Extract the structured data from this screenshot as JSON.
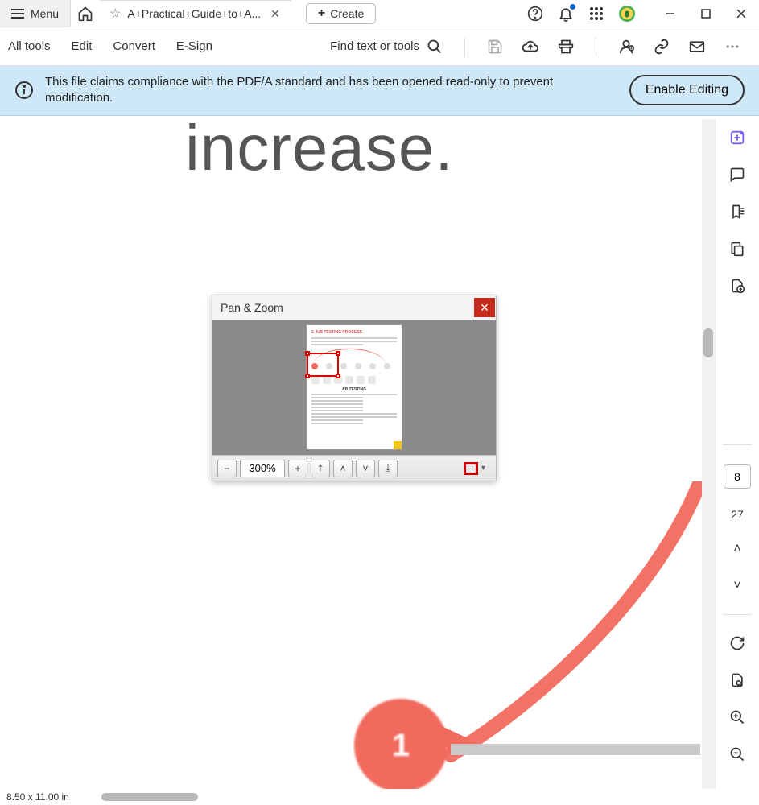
{
  "titlebar": {
    "menu_label": "Menu",
    "tab_title": "A+Practical+Guide+to+A...",
    "create_label": "Create"
  },
  "toolbar": {
    "all_tools": "All tools",
    "edit": "Edit",
    "convert": "Convert",
    "esign": "E-Sign",
    "find": "Find text or tools"
  },
  "banner": {
    "text": "This file claims compliance with the PDF/A standard and has been opened read-only to prevent modification.",
    "button": "Enable Editing"
  },
  "panzoom": {
    "title": "Pan & Zoom",
    "zoom_value": "300%",
    "thumb_heading": "2. A/B TESTING PROCESS",
    "thumb_subheading": "AB TESTING"
  },
  "document": {
    "big_text": "increase.",
    "circle_label": "1"
  },
  "nav": {
    "current_page": "8",
    "total_pages": "27"
  },
  "status": {
    "dimensions": "8.50 x 11.00 in"
  }
}
